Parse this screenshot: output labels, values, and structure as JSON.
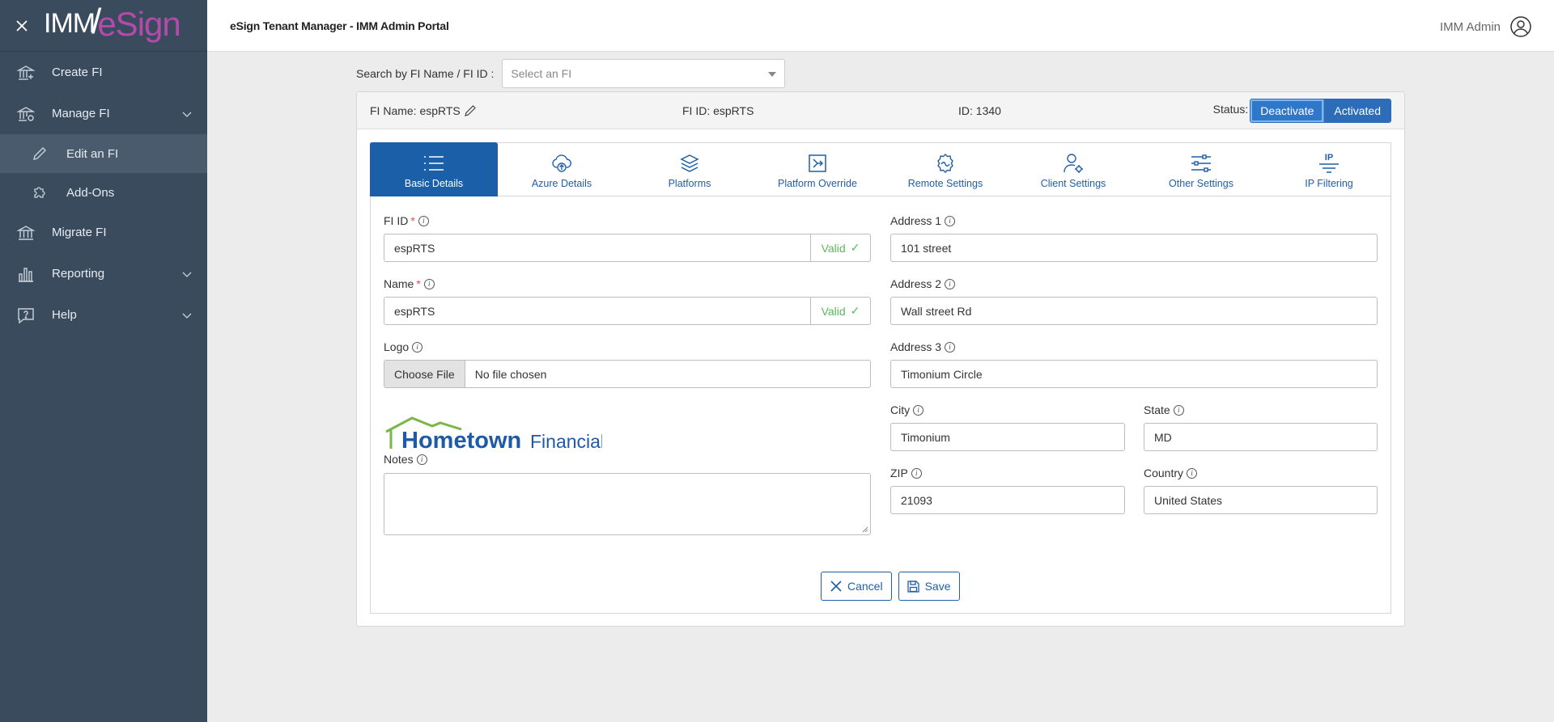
{
  "brand": {
    "imm": "IMM",
    "slash": "/",
    "esign": "eSign"
  },
  "header": {
    "title": "eSign Tenant Manager - IMM Admin Portal",
    "user": "IMM Admin"
  },
  "sidebar": {
    "items": [
      {
        "label": "Create FI",
        "icon": "bank-plus-icon"
      },
      {
        "label": "Manage FI",
        "icon": "bank-gear-icon"
      },
      {
        "label": "Edit an FI",
        "icon": "pencil-icon"
      },
      {
        "label": "Add-Ons",
        "icon": "puzzle-icon"
      },
      {
        "label": "Migrate FI",
        "icon": "bank-icon"
      },
      {
        "label": "Reporting",
        "icon": "bar-chart-icon"
      },
      {
        "label": "Help",
        "icon": "help-icon"
      }
    ]
  },
  "search": {
    "label": "Search by FI Name / FI ID :",
    "placeholder": "Select an FI"
  },
  "fi": {
    "name_label": "FI Name: espRTS",
    "id_label": "FI ID: espRTS",
    "db_id_label": "ID: 1340",
    "status_label": "Status:",
    "deactivate": "Deactivate",
    "activated": "Activated"
  },
  "tabs": [
    {
      "label": "Basic Details",
      "active": true
    },
    {
      "label": "Azure Details"
    },
    {
      "label": "Platforms"
    },
    {
      "label": "Platform Override"
    },
    {
      "label": "Remote Settings"
    },
    {
      "label": "Client Settings"
    },
    {
      "label": "Other Settings"
    },
    {
      "label": "IP Filtering"
    }
  ],
  "form": {
    "fi_id": {
      "label": "FI ID",
      "required": "*",
      "value": "espRTS",
      "valid": "Valid",
      "check": "✓"
    },
    "name": {
      "label": "Name",
      "required": "*",
      "value": "espRTS",
      "valid": "Valid",
      "check": "✓"
    },
    "logo": {
      "label": "Logo",
      "button": "Choose File",
      "status": "No file chosen"
    },
    "logo_image": {
      "word1": "Hometown",
      "word2": "Financial"
    },
    "notes": {
      "label": "Notes",
      "value": ""
    },
    "address1": {
      "label": "Address 1",
      "value": "101 street"
    },
    "address2": {
      "label": "Address 2",
      "value": "Wall street Rd"
    },
    "address3": {
      "label": "Address 3",
      "value": "Timonium Circle"
    },
    "city": {
      "label": "City",
      "value": "Timonium"
    },
    "state": {
      "label": "State",
      "value": "MD"
    },
    "zip": {
      "label": "ZIP",
      "value": "21093"
    },
    "country": {
      "label": "Country",
      "value": "United States"
    },
    "info_glyph": "i"
  },
  "actions": {
    "cancel": "Cancel",
    "save": "Save"
  },
  "ip_tab_text": "IP"
}
